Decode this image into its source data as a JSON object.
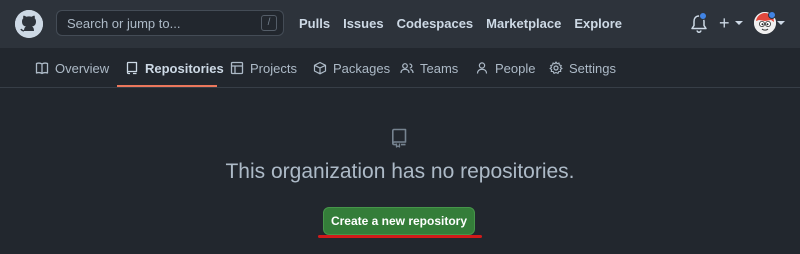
{
  "header": {
    "logo_icon": "github-mark-icon",
    "search": {
      "placeholder": "Search or jump to...",
      "shortcut": "/"
    },
    "nav": [
      "Pulls",
      "Issues",
      "Codespaces",
      "Marketplace",
      "Explore"
    ],
    "icons": [
      "bell-icon",
      "plus-icon",
      "avatar"
    ],
    "indicator_color": "#4184e4"
  },
  "org_nav": {
    "tabs": [
      {
        "label": "Overview",
        "icon": "book-icon",
        "active": false
      },
      {
        "label": "Repositories",
        "icon": "repo-icon",
        "active": true
      },
      {
        "label": "Projects",
        "icon": "table-icon",
        "active": false
      },
      {
        "label": "Packages",
        "icon": "package-icon",
        "active": false
      },
      {
        "label": "Teams",
        "icon": "people-icon",
        "active": false
      },
      {
        "label": "People",
        "icon": "person-icon",
        "active": false
      },
      {
        "label": "Settings",
        "icon": "gear-icon",
        "active": false
      }
    ],
    "active_underline_color": "#ec775c"
  },
  "empty_state": {
    "icon": "repo-icon",
    "title": "This organization has no repositories.",
    "button_label": "Create a new repository",
    "button_color": "#347d39",
    "annotation_color": "#d11a1a"
  }
}
